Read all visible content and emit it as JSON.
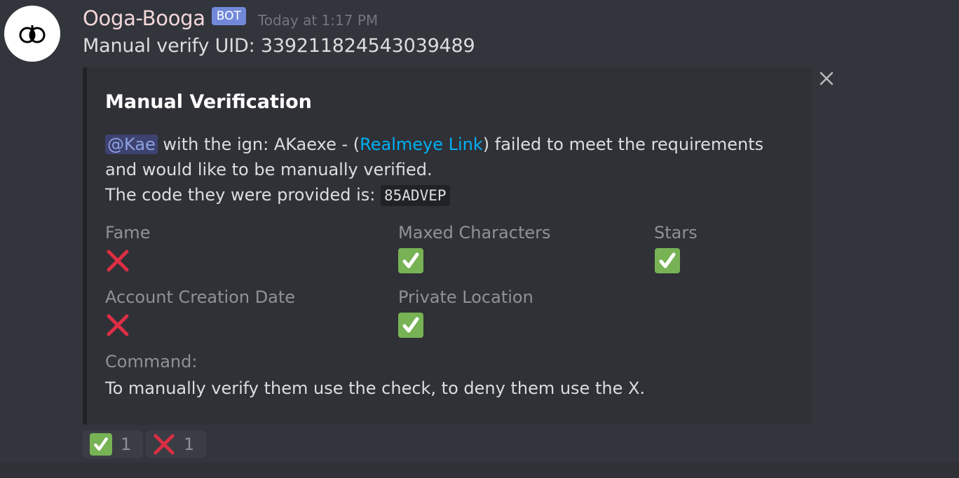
{
  "message": {
    "username": "Ooga-Booga",
    "bot_tag": "BOT",
    "timestamp": "Today at 1:17 PM",
    "content": "Manual verify UID: 339211824543039489"
  },
  "embed": {
    "title": "Manual Verification",
    "mention": "@Kae",
    "desc_part1": " with the ign: AKaexe - (",
    "link_text": "Realmeye Link",
    "desc_part2": ") failed to meet the requirements and would like to be manually verified.",
    "desc_line3": "The code they were provided is: ",
    "code": "85ADVEP",
    "fields": [
      {
        "name": "Fame",
        "value": "cross-mark-icon"
      },
      {
        "name": "Maxed Characters",
        "value": "check-mark-icon"
      },
      {
        "name": "Stars",
        "value": "check-mark-icon"
      },
      {
        "name": "Account Creation Date",
        "value": "cross-mark-icon"
      },
      {
        "name": "Private Location",
        "value": "check-mark-icon"
      },
      {
        "name": "Command:",
        "value": "To manually verify them use the check, to deny them use the X."
      }
    ]
  },
  "reactions": [
    {
      "emoji": "check-mark-icon",
      "count": "1"
    },
    {
      "emoji": "cross-mark-icon",
      "count": "1"
    }
  ],
  "colors": {
    "background": "#32353b",
    "embed_bg": "#2f3136",
    "bot_tag": "#7289da",
    "link": "#00b0f4",
    "check_green": "#77b255",
    "cross_red": "#dd2e44"
  }
}
